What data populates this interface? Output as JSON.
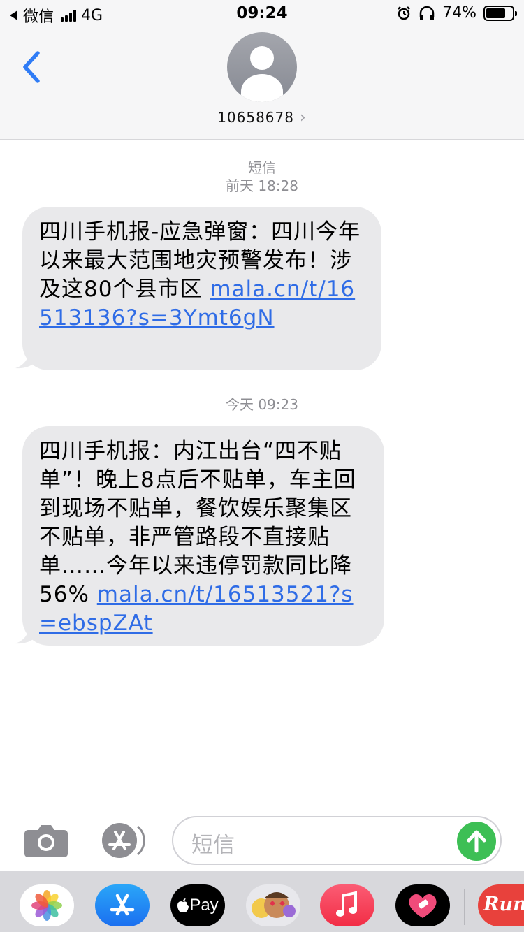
{
  "status_bar": {
    "back_app": "微信",
    "network": "4G",
    "time": "09:24",
    "battery_percent_text": "74%",
    "battery_level": 0.74
  },
  "header": {
    "contact_number": "10658678",
    "chevron": "›"
  },
  "thread": {
    "service_label": "短信",
    "timestamp_1": "前天 18:28",
    "message_1_text": "四川手机报-应急弹窗：四川今年以来最大范围地灾预警发布！涉及这80个县市区 ",
    "message_1_link": "mala.cn/t/16513136?s=3Ymt6gN",
    "timestamp_2": "今天 09:23",
    "message_2_text": "四川手机报：内江出台“四不贴单”！晚上8点后不贴单，车主回到现场不贴单，餐饮娱乐聚集区不贴单，非严管路段不直接贴单……今年以来违停罚款同比降56% ",
    "message_2_link": "mala.cn/t/16513521?s=ebspZAt"
  },
  "composer": {
    "placeholder": "短信"
  },
  "dock": {
    "apple_pay_label": "Pay",
    "last_app_label": "Run"
  },
  "colors": {
    "link": "#2f6ce6",
    "bubble": "#e9e9eb",
    "send": "#3dbf55",
    "back_chevron": "#2f7cf6"
  },
  "icons": [
    "back-chevron-icon",
    "camera-icon",
    "app-store-icon",
    "send-arrow-icon",
    "photos-icon",
    "music-icon",
    "heart-icon"
  ]
}
